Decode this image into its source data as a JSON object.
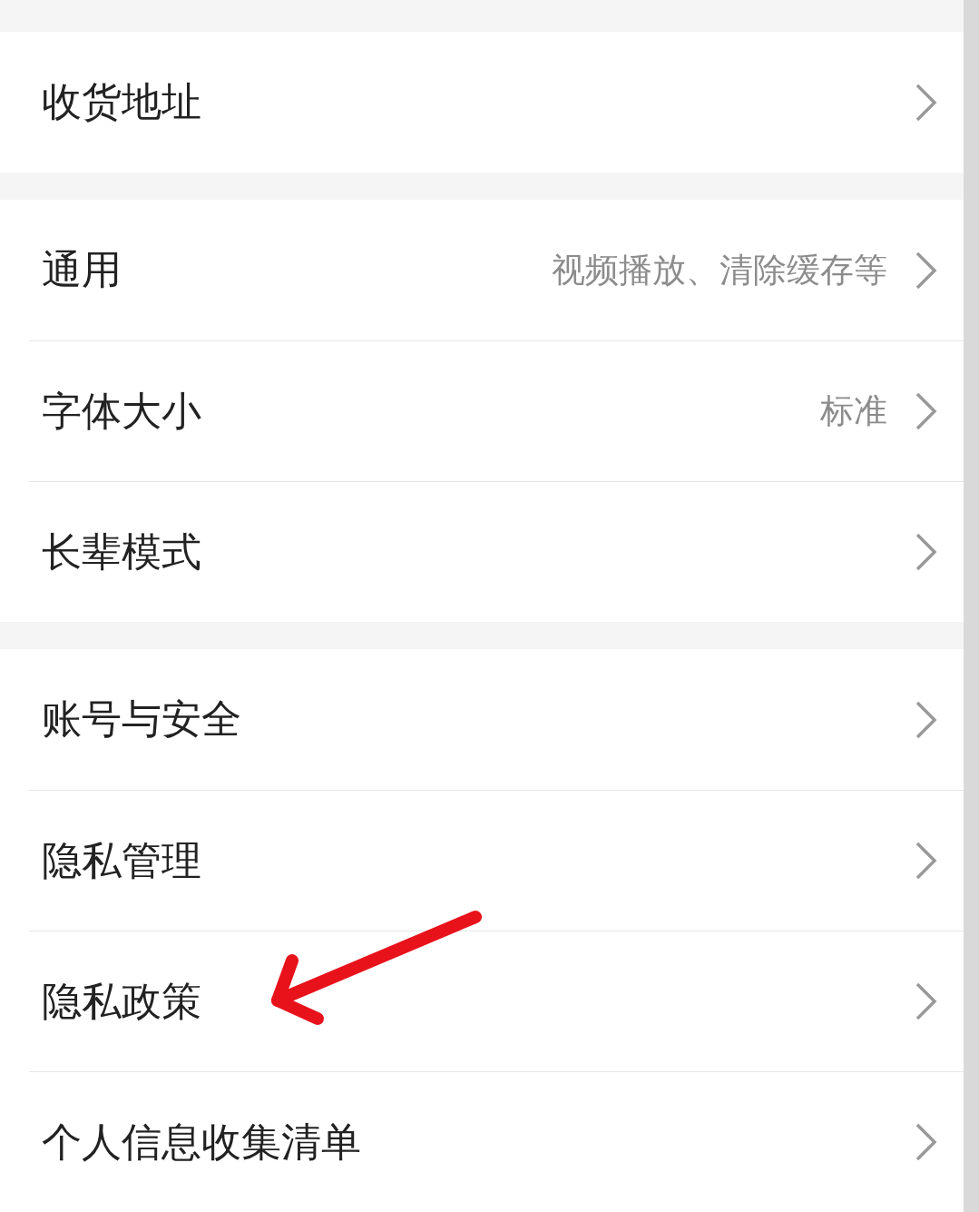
{
  "sections": [
    {
      "items": [
        {
          "label": "收货地址"
        }
      ]
    },
    {
      "items": [
        {
          "label": "通用",
          "value": "视频播放、清除缓存等"
        },
        {
          "label": "字体大小",
          "value": "标准"
        },
        {
          "label": "长辈模式"
        }
      ]
    },
    {
      "items": [
        {
          "label": "账号与安全"
        },
        {
          "label": "隐私管理"
        },
        {
          "label": "隐私政策"
        },
        {
          "label": "个人信息收集清单"
        }
      ]
    }
  ]
}
